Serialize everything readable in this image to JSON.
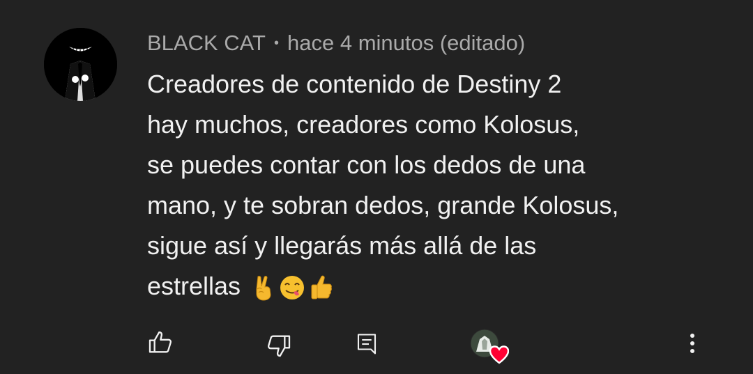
{
  "comment": {
    "author": "BLACK CAT",
    "separator": "•",
    "time": "hace 4 minutos (editado)",
    "lines": [
      "Creadores de contenido de Destiny 2",
      "hay muchos, creadores como Kolosus,",
      "se puedes contar con los dedos de una",
      "mano, y te sobran dedos, grande Kolosus,",
      "sigue así y llegarás más allá de las",
      "estrellas"
    ],
    "emojis": [
      "victory-hand",
      "face-savoring-food",
      "thumbs-up"
    ]
  },
  "actions": {
    "like_icon": "thumbs-up-outline-icon",
    "dislike_icon": "thumbs-down-outline-icon",
    "reply_icon": "comment-reply-icon",
    "creator_heart_icon": "creator-heart-icon",
    "more_icon": "more-vertical-icon"
  },
  "colors": {
    "background": "#222222",
    "text": "#f1f1f1",
    "meta": "#aaaaaa",
    "heart": "#ff0033"
  }
}
